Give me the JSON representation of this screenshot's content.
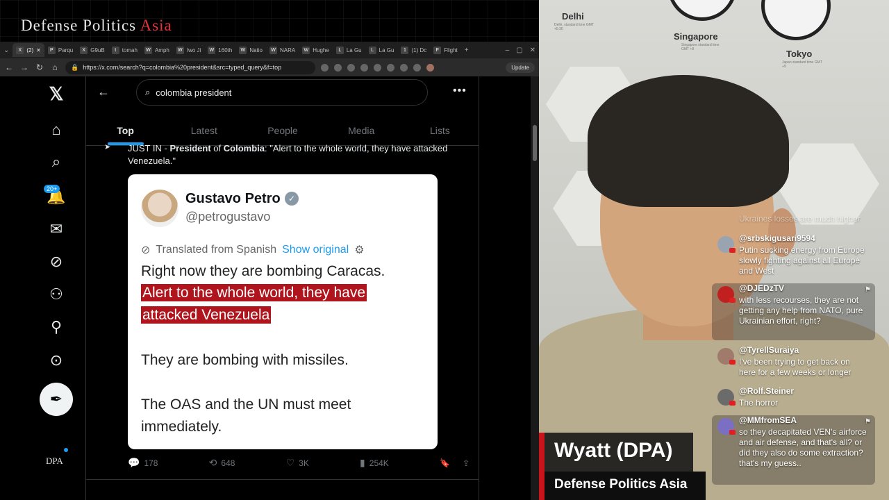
{
  "brand": {
    "part1": "Defense Politics",
    "part2": "Asia"
  },
  "browser": {
    "tabs": [
      {
        "fav": "X",
        "label": "(2)"
      },
      {
        "fav": "P",
        "label": "Parqu"
      },
      {
        "fav": "X",
        "label": "G9uB"
      },
      {
        "fav": "t",
        "label": "tomah"
      },
      {
        "fav": "W",
        "label": "Amph"
      },
      {
        "fav": "W",
        "label": "Iwo Ji"
      },
      {
        "fav": "W",
        "label": "160th"
      },
      {
        "fav": "W",
        "label": "Natio"
      },
      {
        "fav": "W",
        "label": "NARA"
      },
      {
        "fav": "W",
        "label": "Hughe"
      },
      {
        "fav": "L",
        "label": "La Gu"
      },
      {
        "fav": "L",
        "label": "La Gu"
      },
      {
        "fav": "1",
        "label": "(1) Dc"
      },
      {
        "fav": "F",
        "label": "Flight"
      }
    ],
    "add_tab": "+",
    "url": "https://x.com/search?q=colombia%20president&src=typed_query&f=top",
    "update_label": "Update"
  },
  "x": {
    "search_value": "colombia president",
    "more_label": "•••",
    "tabs": [
      "Top",
      "Latest",
      "People",
      "Media",
      "Lists"
    ],
    "notif_badge": "20+",
    "dpa_small": "DPA",
    "tweet": {
      "prefix": "JUST IN - ",
      "bold1": "President",
      "mid": " of ",
      "bold2": "Colombia",
      "rest": ": \"Alert to the whole world, they have attacked Venezuela.\""
    },
    "card": {
      "name": "Gustavo Petro",
      "handle": "@petrogustavo",
      "translated": "Translated from Spanish",
      "show_original": "Show original",
      "line1": "Right now they are bombing Caracas.",
      "hl1": "Alert to the whole world, they have",
      "hl2": "attacked Venezuela",
      "line2": "They are bombing with missiles.",
      "line3": "The OAS and the UN must meet",
      "line4": "immediately."
    },
    "actions": {
      "replies": "178",
      "reposts": "648",
      "likes": "3K",
      "views": "254K"
    }
  },
  "camera": {
    "cities": [
      {
        "name": "Delhi",
        "sub": "Delhi, standard time GMT +5:30"
      },
      {
        "name": "Singapore",
        "sub": "Singapore standard time GMT +8"
      },
      {
        "name": "Tokyo",
        "sub": "Japan standard time GMT +9"
      }
    ]
  },
  "chat": [
    {
      "name": "",
      "text": "Ukraines losses are much higher"
    },
    {
      "name": "@srbskigusari9594",
      "text": "Putin sucking energy from Europe slowly fighting against all Europe and West"
    },
    {
      "name": "@DJEDzTV",
      "text": "with less recourses, they are not getting any help from NATO, pure Ukrainian effort, right?"
    },
    {
      "name": "@TyrellSuraiya",
      "text": "I've been trying to get back on here for a few weeks or longer"
    },
    {
      "name": "@Rolf.Steiner",
      "text": "The horror"
    },
    {
      "name": "@MMfromSEA",
      "text": "so they decapitated VEN's airforce and air defense, and that's all? or did they also do some extraction? that's my guess.."
    }
  ],
  "lower_third": {
    "name": "Wyatt (DPA)",
    "org": "Defense Politics Asia"
  },
  "colors": {
    "x_blue": "#1d9bf0",
    "highlight_red": "#b0141c",
    "brand_red": "#e6353a"
  }
}
